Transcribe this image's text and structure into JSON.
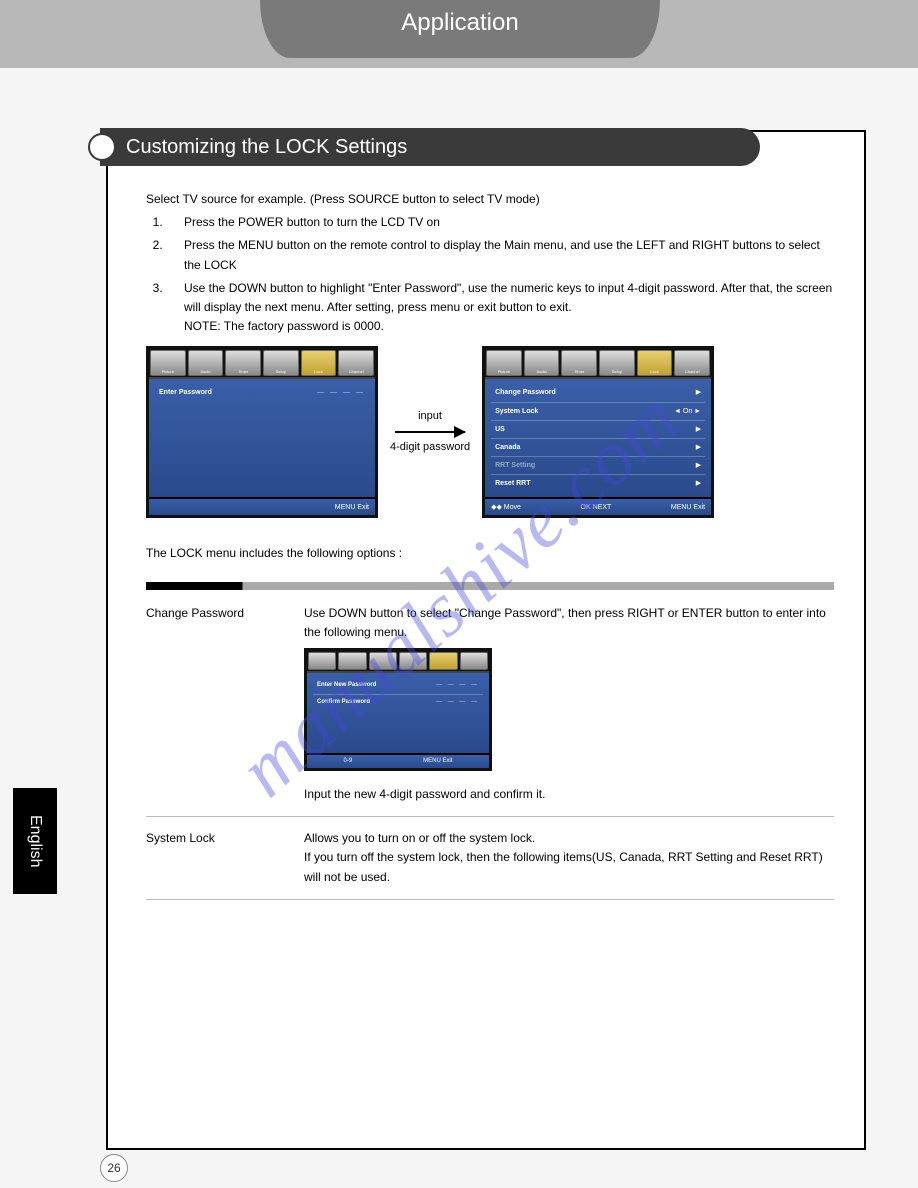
{
  "header": {
    "tab": "Application"
  },
  "section": {
    "title": "Customizing the LOCK Settings"
  },
  "intro": "Select TV source for example. (Press SOURCE button to select TV mode)",
  "steps": [
    "Press the POWER button to turn the LCD TV on",
    "Press the MENU button on the remote control to display the Main menu, and use the LEFT and RIGHT buttons to select the LOCK",
    "Use the DOWN button to highlight \"Enter Password\", use the numeric keys to input 4-digit password. After that, the screen will display the next menu. After setting, press menu or exit button to exit."
  ],
  "note": "NOTE: The factory password is 0000.",
  "tabs": [
    "Picture",
    "Audio",
    "Timer",
    "Setup",
    "Lock",
    "Channel"
  ],
  "screen1": {
    "row_label": "Enter Password",
    "dashes": "— — — —",
    "footer_exit": "MENU Exit"
  },
  "arrow": {
    "top": "input",
    "bottom": "4-digit password"
  },
  "screen2": {
    "rows": [
      {
        "label": "Change Password",
        "right": "▶"
      },
      {
        "label": "System Lock",
        "mid": "◄   On   ►",
        "right": ""
      },
      {
        "label": "US",
        "right": "▶"
      },
      {
        "label": "Canada",
        "right": "▶"
      },
      {
        "label": "RRT Setting",
        "right": "▶",
        "dim": true
      },
      {
        "label": "Reset RRT",
        "right": "▶"
      }
    ],
    "footer": {
      "move": "◆◆ Move",
      "next": "OK NEXT",
      "exit": "MENU Exit"
    }
  },
  "options_intro": "The LOCK menu includes the following options :",
  "opt1": {
    "label": "Change Password",
    "desc": "Use DOWN button to select \"Change Password\", then press RIGHT or ENTER button to enter into the following menu.",
    "screen": {
      "rows": [
        {
          "label": "Enter New Password",
          "dashes": "— — — —"
        },
        {
          "label": "Confirm Password",
          "dashes": "— — — —"
        }
      ],
      "footer": {
        "left": "0-9",
        "right": "MENU Exit"
      }
    },
    "after": "Input the new 4-digit password and confirm it."
  },
  "opt2": {
    "label": "System Lock",
    "desc": "Allows you to turn on or off the system lock.\nIf you turn off the system lock, then the following items(US, Canada, RRT Setting and Reset RRT) will not be used."
  },
  "language": "English",
  "page_number": "26",
  "watermark": "manualshive.com"
}
